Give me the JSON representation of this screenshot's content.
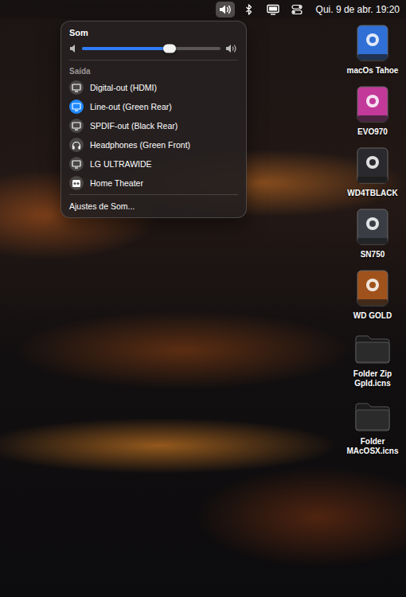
{
  "menubar": {
    "items": [
      {
        "kind": "volume",
        "selected": true
      },
      {
        "kind": "bluetooth",
        "selected": false
      },
      {
        "kind": "display",
        "selected": false
      },
      {
        "kind": "control-center",
        "selected": false
      }
    ],
    "clock": "Qui. 9 de abr. 19:20"
  },
  "sound_menu": {
    "title": "Som",
    "volume": {
      "level": 0.63
    },
    "section": "Saída",
    "outputs": [
      {
        "label": "Digital-out (HDMI)",
        "kind": "display",
        "selected": false
      },
      {
        "label": "Line-out (Green Rear)",
        "kind": "display",
        "selected": true
      },
      {
        "label": "SPDIF-out (Black Rear)",
        "kind": "display",
        "selected": false
      },
      {
        "label": "Headphones (Green Front)",
        "kind": "headphones",
        "selected": false
      },
      {
        "label": "LG ULTRAWIDE",
        "kind": "display",
        "selected": false
      },
      {
        "label": "Home Theater",
        "kind": "speaker",
        "selected": false
      }
    ],
    "footer": "Ajustes de Som..."
  },
  "desktop": {
    "icons": [
      {
        "label": "macOs Tahoe",
        "kind": "drive",
        "color": "#2f6fd6"
      },
      {
        "label": "EVO970",
        "kind": "drive",
        "color": "#c2399a"
      },
      {
        "label": "WD4TBLACK",
        "kind": "drive",
        "color": "#2a2a2e"
      },
      {
        "label": "SN750",
        "kind": "drive",
        "color": "#3a3d44"
      },
      {
        "label": "WD GOLD",
        "kind": "drive",
        "color": "#a0521c"
      },
      {
        "label": "Folder Zip Gpld.icns",
        "kind": "folder",
        "color": "#1c1c1c"
      },
      {
        "label": "Folder MAcOSX.icns",
        "kind": "folder",
        "color": "#1c1c1c"
      }
    ]
  }
}
